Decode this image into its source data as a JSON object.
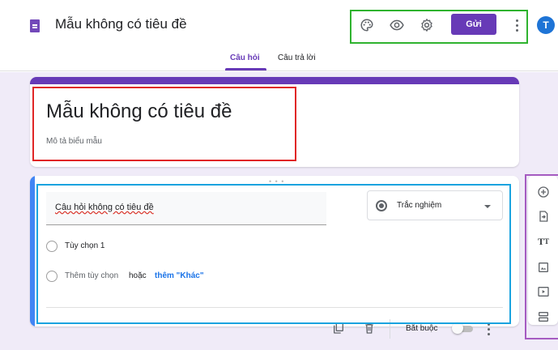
{
  "header": {
    "doc_title": "Mẫu không có tiêu đề",
    "toolbar": {
      "palette_icon": "palette-icon",
      "preview_icon": "eye-icon",
      "settings_icon": "gear-icon",
      "send_label": "Gửi",
      "more_icon": "more-vert-icon"
    },
    "avatar_initial": "T",
    "avatar_color": "#1e74d6"
  },
  "tabs": [
    {
      "label": "Câu hỏi",
      "active": true
    },
    {
      "label": "Câu trả lời",
      "active": false
    }
  ],
  "form": {
    "title": "Mẫu không có tiêu đề",
    "description_placeholder": "Mô tả biểu mẫu"
  },
  "question": {
    "title": "Câu hỏi không có tiêu đề",
    "type_label": "Trắc nghiệm",
    "option1": "Tùy chọn 1",
    "add_option": "Thêm tùy chọn",
    "or_label": "hoặc",
    "add_other": "thêm \"Khác\"",
    "required_label": "Bắt buộc",
    "required_on": false
  },
  "sidebar": {
    "items": [
      "add-question-icon",
      "import-questions-icon",
      "add-title-text-icon",
      "add-image-icon",
      "add-video-icon",
      "add-section-icon"
    ]
  },
  "colors": {
    "accent": "#673ab7",
    "background": "#f0ebf8",
    "question_accent": "#4285f4",
    "link": "#1a73e8"
  }
}
